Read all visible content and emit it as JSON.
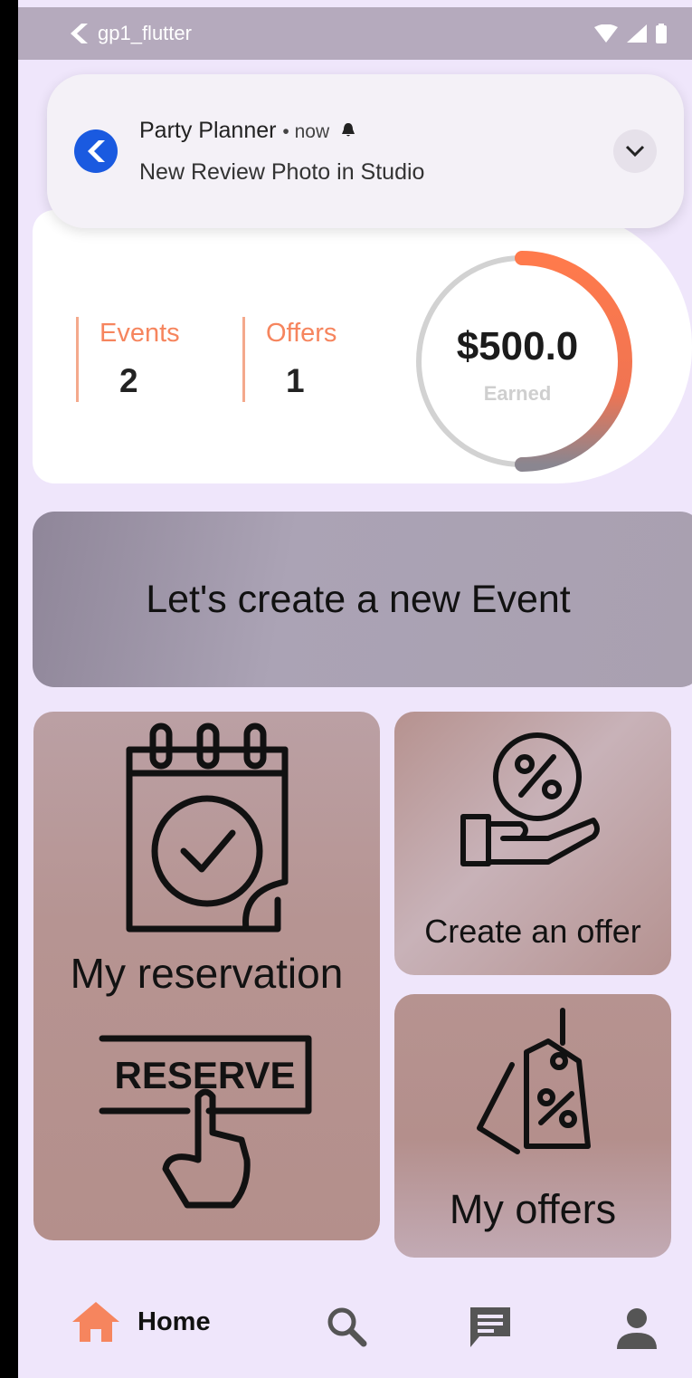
{
  "status_bar": {
    "app_name": "gp1_flutter"
  },
  "notification": {
    "app": "Party Planner",
    "time": "• now",
    "message": "New Review Photo in Studio"
  },
  "stats": {
    "events_label": "Events",
    "events_value": "2",
    "offers_label": "Offers",
    "offers_value": "1",
    "earned_amount": "$500.0",
    "earned_label": "Earned",
    "progress_fraction": 0.5
  },
  "banner": {
    "label": "Let's create a new Event"
  },
  "tiles": {
    "reservation": {
      "label": "My reservation",
      "reserve_text": "RESERVE"
    },
    "create_offer": {
      "label": "Create an offer"
    },
    "my_offers": {
      "label": "My offers"
    }
  },
  "nav": {
    "home_label": "Home"
  },
  "colors": {
    "accent": "#f6855e",
    "background": "#efe6fb",
    "banner": "#aba3b5",
    "tile": "#b59290"
  },
  "icons": [
    "flutter-icon",
    "wifi-icon",
    "signal-icon",
    "battery-icon",
    "bell-icon",
    "chevron-down-icon",
    "calendar-check-icon",
    "percent-hand-icon",
    "price-tag-icon",
    "home-icon",
    "search-icon",
    "chat-icon",
    "person-icon"
  ]
}
